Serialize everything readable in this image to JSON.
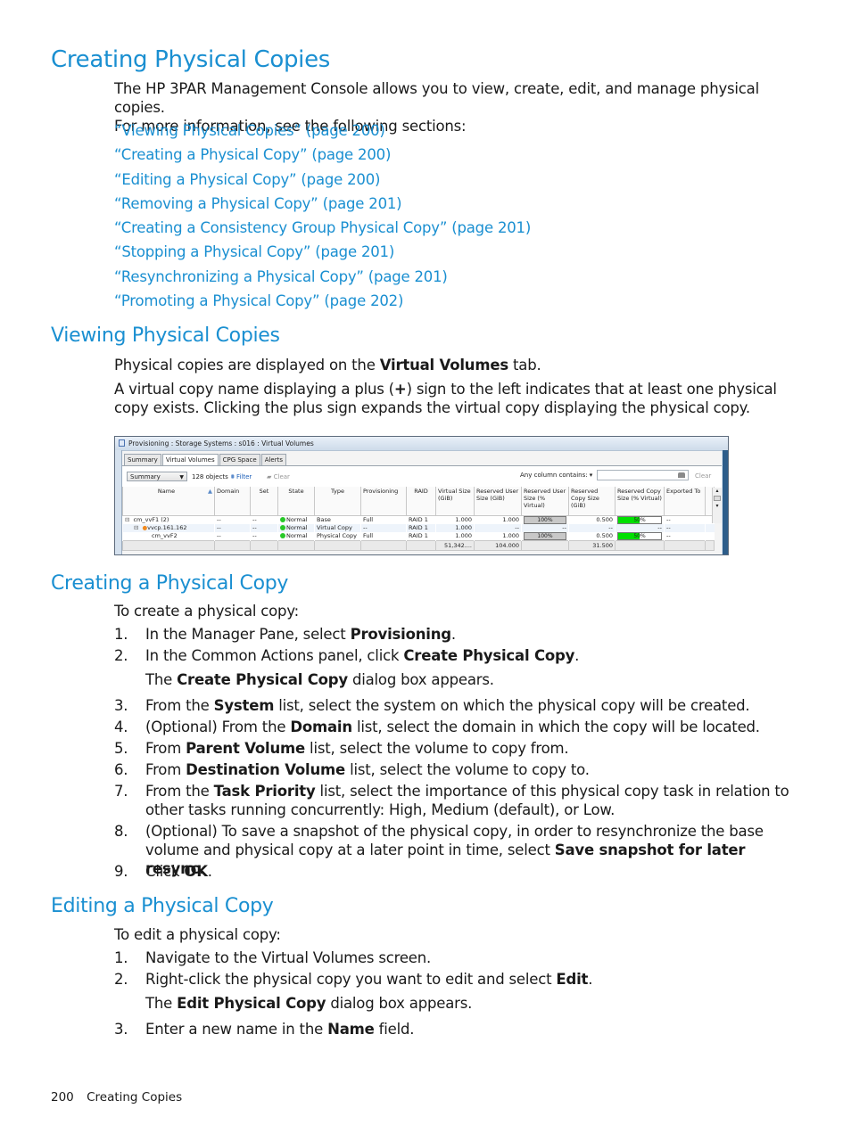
{
  "page": {
    "title": "Creating Physical Copies",
    "intro_line1": "The HP 3PAR Management Console allows you to view, create, edit, and manage physical copies.",
    "intro_line2": "For more information, see the following sections:",
    "links": [
      "“Viewing Physical Copies” (page 200)",
      "“Creating a Physical Copy” (page 200)",
      "“Editing a Physical Copy” (page 200)",
      "“Removing a Physical Copy” (page 201)",
      "“Creating a Consistency Group Physical Copy” (page 201)",
      "“Stopping a Physical Copy” (page 201)",
      "“Resynchronizing a Physical Copy” (page 201)",
      "“Promoting a Physical Copy” (page 202)"
    ],
    "heading_color": "#1a8fd1"
  },
  "viewing": {
    "heading": "Viewing Physical Copies",
    "p1_a": "Physical copies are displayed on the ",
    "p1_b": "Virtual Volumes",
    "p1_c": " tab.",
    "p2_a": "A virtual copy name displaying a plus (",
    "p2_b": "+",
    "p2_c": ") sign to the left indicates that at least one physical copy exists. Clicking the plus sign expands the virtual copy displaying the physical copy."
  },
  "screenshot": {
    "window_title": "Provisioning : Storage Systems : s016 : Virtual Volumes",
    "tabs": [
      "Summary",
      "Virtual Volumes",
      "CPG Space",
      "Alerts"
    ],
    "active_tab": "Virtual Volumes",
    "view_select": "Summary",
    "object_count": "128 objects",
    "filter_label": "Filter",
    "clear_label": "Clear",
    "any_column_label": "Any column contains:  ▾",
    "search_value": "",
    "clear2_label": "Clear",
    "columns": [
      "Name",
      "Domain",
      "Set",
      "State",
      "Type",
      "Provisioning",
      "RAID",
      "Virtual Size (GiB)",
      "Reserved User Size (GiB)",
      "Reserved User Size (% Virtual)",
      "Reserved Copy Size (GiB)",
      "Reserved Copy Size (% Virtual)",
      "Exported To"
    ],
    "rows": [
      {
        "expander": "⊟",
        "name": "cm_vvF1  (2)",
        "domain": "--",
        "set": "--",
        "state": "Normal",
        "type": "Base",
        "provisioning": "Full",
        "raid": "RAID 1",
        "virtual_size": "1.000",
        "res_user_gib": "1.000",
        "res_user_pct": 100,
        "res_user_pct_label": "100%",
        "res_copy_gib": "0.500",
        "res_copy_pct": 50,
        "res_copy_pct_label": "50%",
        "exported_to": "--"
      },
      {
        "expander": "⊟",
        "name": "vvcp.161.162",
        "domain": "--",
        "set": "--",
        "state": "Normal",
        "type": "Virtual Copy",
        "provisioning": "--",
        "raid": "RAID 1",
        "virtual_size": "1.000",
        "res_user_gib": "--",
        "res_user_pct_label": "--",
        "res_copy_gib": "--",
        "res_copy_pct_label": "--",
        "exported_to": "--"
      },
      {
        "expander": "",
        "name": "cm_vvF2",
        "domain": "--",
        "set": "--",
        "state": "Normal",
        "type": "Physical Copy",
        "provisioning": "Full",
        "raid": "RAID 1",
        "virtual_size": "1.000",
        "res_user_gib": "1.000",
        "res_user_pct": 100,
        "res_user_pct_label": "100%",
        "res_copy_gib": "0.500",
        "res_copy_pct": 50,
        "res_copy_pct_label": "50%",
        "exported_to": "--"
      }
    ],
    "totals": {
      "virtual_size": "51,342....",
      "res_user_gib": "104.000",
      "res_copy_gib": "31.500"
    }
  },
  "creating": {
    "heading": "Creating a Physical Copy",
    "intro": "To create a physical copy:",
    "steps": [
      {
        "n": "1.",
        "a": "In the Manager Pane, select ",
        "b": "Provisioning",
        "c": "."
      },
      {
        "n": "2.",
        "a": "In the Common Actions panel, click ",
        "b": "Create Physical Copy",
        "c": "."
      },
      {
        "n": "",
        "a": "The ",
        "b": "Create Physical Copy",
        "c": " dialog box appears."
      },
      {
        "n": "3.",
        "a": "From the ",
        "b": "System",
        "c": " list, select the system on which the physical copy will be created."
      },
      {
        "n": "4.",
        "a": "(Optional) From the ",
        "b": "Domain",
        "c": " list, select the domain in which the copy will be located."
      },
      {
        "n": "5.",
        "a": "From ",
        "b": "Parent Volume",
        "c": " list, select the volume to copy from."
      },
      {
        "n": "6.",
        "a": "From ",
        "b": "Destination Volume",
        "c": " list, select the volume to copy to."
      },
      {
        "n": "7.",
        "a": "From the ",
        "b": "Task Priority",
        "c": " list, select the importance of this physical copy task in relation to other tasks running concurrently: High, Medium (default), or Low."
      },
      {
        "n": "8.",
        "a": "(Optional) To save a snapshot of the physical copy, in order to resynchronize the base volume and physical copy at a later point in time, select ",
        "b": "Save snapshot for later resync",
        "c": "."
      },
      {
        "n": "9.",
        "a": "Click ",
        "b": "OK",
        "c": "."
      }
    ]
  },
  "editing": {
    "heading": "Editing a Physical Copy",
    "intro": "To edit a physical copy:",
    "steps": [
      {
        "n": "1.",
        "a": "Navigate to the Virtual Volumes screen.",
        "b": "",
        "c": ""
      },
      {
        "n": "2.",
        "a": "Right-click the physical copy you want to edit and select ",
        "b": "Edit",
        "c": "."
      },
      {
        "n": "",
        "a": "The ",
        "b": "Edit Physical Copy",
        "c": " dialog box appears."
      },
      {
        "n": "3.",
        "a": "Enter a new name in the ",
        "b": "Name",
        "c": " field."
      }
    ]
  },
  "footer": {
    "page_number": "200",
    "section": "Creating Copies"
  }
}
